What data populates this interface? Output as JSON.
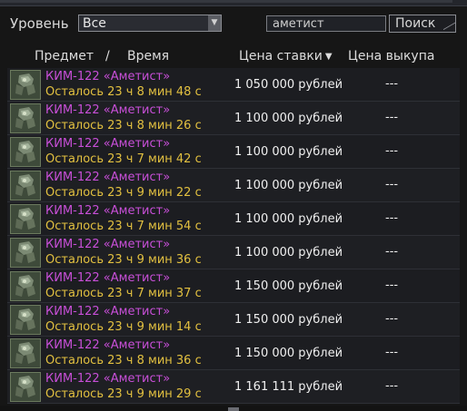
{
  "filters": {
    "level_label": "Уровень",
    "level_value": "Все",
    "search_value": "аметист",
    "search_button": "Поиск"
  },
  "columns": {
    "item": "Предмет",
    "separator": "/",
    "time": "Время",
    "bid": "Цена ставки",
    "bid_sort_indicator": "▼",
    "buyout": "Цена выкупа"
  },
  "colors": {
    "item_name": "#c84fd8",
    "time_left": "#e2c040",
    "price": "#f0f0f0"
  },
  "lots": [
    {
      "icon": "cyborg-armor-icon",
      "name": "КИМ-122 «Аметист»",
      "time": "Осталось 23 ч 8 мин 48 с",
      "bid": "1 050 000 рублей",
      "buyout": "---"
    },
    {
      "icon": "cyborg-armor-icon",
      "name": "КИМ-122 «Аметист»",
      "time": "Осталось 23 ч 8 мин 26 с",
      "bid": "1 100 000 рублей",
      "buyout": "---"
    },
    {
      "icon": "cyborg-armor-icon",
      "name": "КИМ-122 «Аметист»",
      "time": "Осталось 23 ч 7 мин 42 с",
      "bid": "1 100 000 рублей",
      "buyout": "---"
    },
    {
      "icon": "cyborg-armor-icon",
      "name": "КИМ-122 «Аметист»",
      "time": "Осталось 23 ч 9 мин 22 с",
      "bid": "1 100 000 рублей",
      "buyout": "---"
    },
    {
      "icon": "cyborg-armor-icon",
      "name": "КИМ-122 «Аметист»",
      "time": "Осталось 23 ч 7 мин 54 с",
      "bid": "1 100 000 рублей",
      "buyout": "---"
    },
    {
      "icon": "cyborg-armor-icon",
      "name": "КИМ-122 «Аметист»",
      "time": "Осталось 23 ч 9 мин 36 с",
      "bid": "1 100 000 рублей",
      "buyout": "---"
    },
    {
      "icon": "cyborg-armor-icon",
      "name": "КИМ-122 «Аметист»",
      "time": "Осталось 23 ч 7 мин 37 с",
      "bid": "1 150 000 рублей",
      "buyout": "---"
    },
    {
      "icon": "cyborg-armor-icon",
      "name": "КИМ-122 «Аметист»",
      "time": "Осталось 23 ч 9 мин 14 с",
      "bid": "1 150 000 рублей",
      "buyout": "---"
    },
    {
      "icon": "cyborg-armor-icon",
      "name": "КИМ-122 «Аметист»",
      "time": "Осталось 23 ч 8 мин 36 с",
      "bid": "1 150 000 рублей",
      "buyout": "---"
    },
    {
      "icon": "cyborg-armor-icon",
      "name": "КИМ-122 «Аметист»",
      "time": "Осталось 23 ч 9 мин 29 с",
      "bid": "1 161 111 рублей",
      "buyout": "---"
    }
  ]
}
